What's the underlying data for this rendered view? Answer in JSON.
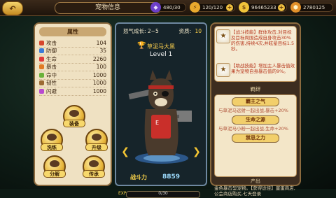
{
  "header": {
    "title": "宠物信息",
    "resources": [
      {
        "icon": "gem-icon",
        "value": "480/30",
        "color": "#b48cff"
      },
      {
        "icon": "stamina-icon",
        "value": "120/120",
        "color": "#ffc93a"
      },
      {
        "icon": "coin-icon",
        "value": "96465233",
        "color": "#ffd24a"
      },
      {
        "icon": "gold-ingot-icon",
        "value": "2780125",
        "color": "#f2a93b"
      }
    ]
  },
  "attributes": {
    "title": "属性",
    "rows": [
      {
        "label": "攻击",
        "value": "104",
        "color": "#d6452c"
      },
      {
        "label": "防御",
        "value": "35",
        "color": "#3b7bd8"
      },
      {
        "label": "生命",
        "value": "2260",
        "color": "#e03a3a"
      },
      {
        "label": "暴击",
        "value": "100",
        "color": "#e17a23"
      },
      {
        "label": "命中",
        "value": "1000",
        "color": "#6ab23a"
      },
      {
        "label": "韧性",
        "value": "1000",
        "color": "#9c6b34"
      },
      {
        "label": "闪避",
        "value": "1000",
        "color": "#b84ad0"
      }
    ],
    "buttons": [
      "装备",
      "洗练",
      "升级",
      "分解",
      "传承"
    ]
  },
  "pet": {
    "rage_label": "怒气成长: 2~5",
    "quality_label": "资质:",
    "quality_value": "10",
    "name": "草泥马大黑",
    "level": "Level 1",
    "power_label": "战斗力",
    "power_value": "8859",
    "exp_label": "EXP",
    "exp_value": "0/30"
  },
  "skills": [
    {
      "icon": "star-icon",
      "text": "【战斗技能】群体攻击,对目标及目标周围造成自身攻击30%的伤害,持续4次,并眩晕目标1.5秒。"
    },
    {
      "icon": "star-icon",
      "text": "【助战技能】增加主人暴击值效果为宠物自身暴击值的9%。"
    }
  ],
  "fate": {
    "title": "羁绊",
    "items": [
      {
        "name": "霸主之气",
        "desc": "与草泥马远射一起出战,暴击+20%"
      },
      {
        "name": "生命之源",
        "desc": "与草泥马小粉一起出战,生命+20%"
      },
      {
        "name": "禁忌之力",
        "desc": ""
      }
    ]
  },
  "output": {
    "title": "产出",
    "text": "金色暴击型宠物。【获得途径】蛋蛋商店,公会商店购买,七天登录"
  }
}
